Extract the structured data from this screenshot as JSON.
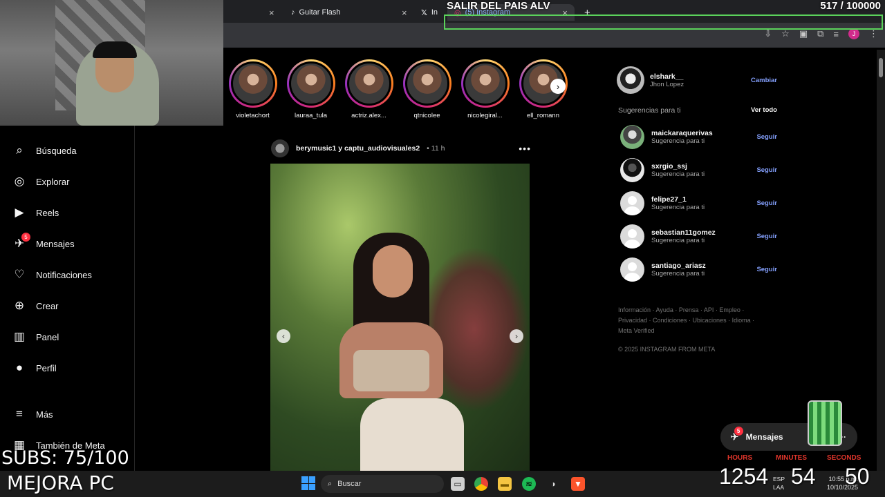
{
  "browser": {
    "tabs": [
      {
        "label": "",
        "close": "×"
      },
      {
        "label": "Guitar Flash",
        "close": "×"
      },
      {
        "label": "In",
        "close": ""
      },
      {
        "label": "(5) Instagram",
        "close": "×"
      },
      {
        "label": "+",
        "close": ""
      }
    ],
    "profile_initial": "J"
  },
  "overlay": {
    "title": "SALIR DEL PAIS ALV",
    "counter": "517 / 100000",
    "subs": "SUBS: 75/100",
    "brand": "MEJORA PC",
    "timer": {
      "labels": [
        "HOURS",
        "MINUTES",
        "SECONDS"
      ],
      "values": [
        "1254",
        "54",
        "50"
      ]
    }
  },
  "nav": {
    "items": [
      {
        "label": "Búsqueda",
        "icon": "search-icon"
      },
      {
        "label": "Explorar",
        "icon": "compass-icon"
      },
      {
        "label": "Reels",
        "icon": "reels-icon"
      },
      {
        "label": "Mensajes",
        "icon": "messenger-icon",
        "badge": "5"
      },
      {
        "label": "Notificaciones",
        "icon": "heart-icon"
      },
      {
        "label": "Crear",
        "icon": "plus-square-icon"
      },
      {
        "label": "Panel",
        "icon": "chart-icon"
      },
      {
        "label": "Perfil",
        "icon": "profile-icon"
      },
      {
        "label": "Más",
        "icon": "menu-icon"
      },
      {
        "label": "También de Meta",
        "icon": "meta-icon"
      }
    ]
  },
  "stories": [
    {
      "name": "violetachort"
    },
    {
      "name": "lauraa_tula"
    },
    {
      "name": "actriz.alex..."
    },
    {
      "name": "qtnicolee"
    },
    {
      "name": "nicolegiral..."
    },
    {
      "name": "ell_romann"
    }
  ],
  "post": {
    "users": "berymusic1 y captu_audiovisuales2",
    "time": "• 11 h",
    "more": "•••"
  },
  "me": {
    "username": "elshark__",
    "fullname": "Jhon Lopez",
    "switch_label": "Cambiar"
  },
  "suggestions": {
    "heading": "Sugerencias para ti",
    "see_all": "Ver todo",
    "follow_label": "Seguir",
    "items": [
      {
        "username": "maickaraquerivas",
        "sub": "Sugerencia para ti"
      },
      {
        "username": "sxrgio_ssj",
        "sub": "Sugerencia para ti"
      },
      {
        "username": "felipe27_1",
        "sub": "Sugerencia para ti"
      },
      {
        "username": "sebastian11gomez",
        "sub": "Sugerencia para ti"
      },
      {
        "username": "santiago_ariasz",
        "sub": "Sugerencia para ti"
      }
    ]
  },
  "footer": {
    "links": "Información · Ayuda · Prensa · API · Empleo · Privacidad · Condiciones · Ubicaciones · Idioma · Meta Verified",
    "copyright": "© 2025 INSTAGRAM FROM META"
  },
  "messages_pill": {
    "label": "Mensajes",
    "badge": "5"
  },
  "taskbar": {
    "search_label": "Buscar",
    "lang": "ESP",
    "lang2": "LAA",
    "time": "10:55 p.m.",
    "date": "10/10/2025"
  }
}
